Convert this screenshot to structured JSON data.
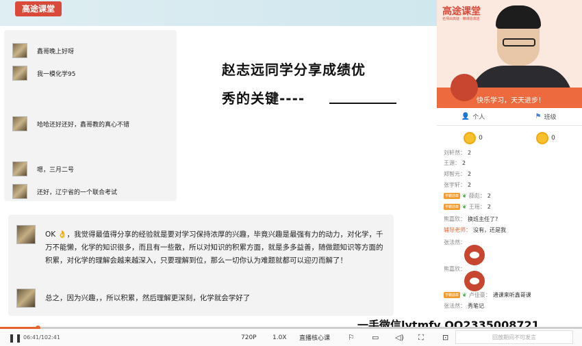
{
  "brand": {
    "logo": "高途课堂"
  },
  "video": {
    "logo": "高途课堂",
    "sub": "名师出高徒 · 精课造高途",
    "banner": "快乐学习，天天进步！"
  },
  "chat_left": [
    {
      "text": "鑫哥晚上好呀"
    },
    {
      "text": "我一模化学95"
    },
    {
      "text": "哈哈还好还好，鑫哥教的真心不错"
    },
    {
      "text": "嗯，三月二号"
    },
    {
      "text": "还好，辽宁省的一个联合考试"
    }
  ],
  "slide": {
    "title_line1": "赵志远同学分享成绩优",
    "title_line2": "秀的关键----",
    "long_message": "OK 👌，我觉得最值得分享的经验就是要对学习保持浓厚的兴趣，毕竟兴趣是最强有力的动力，对化学，千万不能懒，化学的知识很多，而且有一些散，所以对知识的积累方面，就是多多益善，随做题知识等方面的积累，对化学的理解会越来越深入，只要理解到位，那么一切你认为难题就都可以迎刃而解了！",
    "summary": "总之，因为兴趣，，所以积累，然后理解更深刻，化学就会学好了"
  },
  "tabs": [
    {
      "label": "个人",
      "icon": "person-icon"
    },
    {
      "label": "班级",
      "icon": "flag-icon"
    }
  ],
  "coins": [
    {
      "value": "0"
    },
    {
      "value": "0"
    }
  ],
  "chat_right": [
    {
      "name": "刘轩然：",
      "msg": "2"
    },
    {
      "name": "王源：",
      "msg": "2"
    },
    {
      "name": "郑智元：",
      "msg": "2"
    },
    {
      "name": "张宇轩：",
      "msg": "2"
    },
    {
      "badge": "学霸勋章",
      "name": "薛彪：",
      "msg": "2"
    },
    {
      "badge": "学霸勋章",
      "name": "王瑶：",
      "msg": "2"
    },
    {
      "name": "熊嘉欣：",
      "msg": "换班主任了?"
    },
    {
      "teacher": "辅导老师：",
      "msg": "没有，还是我"
    },
    {
      "name": "张法然：",
      "msg": ""
    },
    {
      "name": "熊嘉欣：",
      "msg": ""
    },
    {
      "badge": "学霸勋章",
      "name": "卢佳豪：",
      "msg": "通课来听鑫哥课"
    },
    {
      "name": "张法然：",
      "msg": "秀笔记"
    },
    {
      "name": "",
      "msg": ""
    }
  ],
  "watermark": "一手微信lytmfy QQ2335008721",
  "player": {
    "current": "06:41",
    "total": "102:41",
    "progress": 0.065,
    "quality": "720P",
    "speed": "1.0X",
    "mode": "直播核心课",
    "input_placeholder": "回放期间不可发言"
  }
}
